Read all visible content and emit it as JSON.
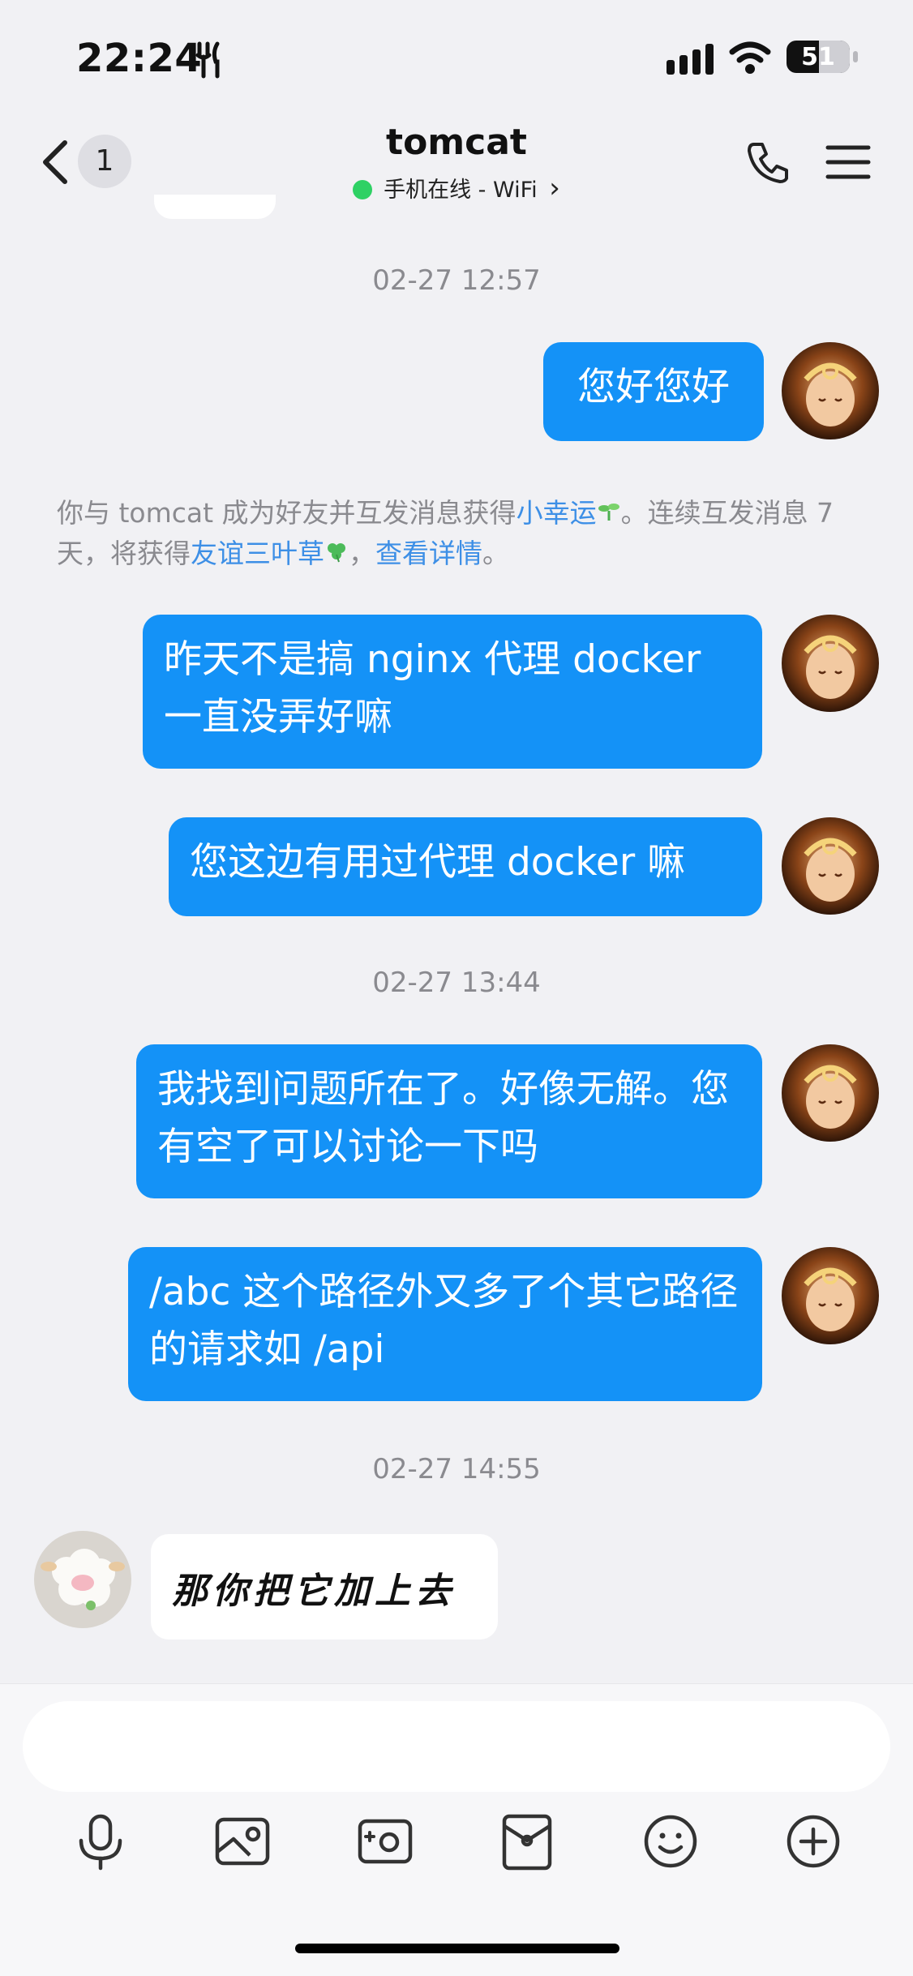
{
  "status_bar": {
    "time": "22:24",
    "battery": "51"
  },
  "header": {
    "unread_count": "1",
    "contact_name": "tomcat",
    "contact_status": "手机在线 - WiFi",
    "status_chevron": "›"
  },
  "top_partial_bubble": "",
  "messages": {
    "ts1": "02-27 12:57",
    "m1": "您好您好",
    "notice": {
      "p1": "你与 tomcat 成为好友并互发消息获得",
      "link1": "小幸运",
      "p2": "。连续互发消息 7 天，将获得",
      "link2": "友谊三叶草",
      "p3": "，",
      "link3": "查看详情",
      "p4": "。"
    },
    "m2": "昨天不是搞 nginx 代理 docker 一直没弄好嘛",
    "m3": "您这边有用过代理 docker 嘛",
    "ts2": "02-27 13:44",
    "m4": "我找到问题所在了。好像无解。您有空了可以讨论一下吗",
    "m5": "/abc 这个路径外又多了个其它路径的请求如 /api",
    "ts3": "02-27 14:55",
    "m6": "那你把它加上去"
  },
  "composer": {
    "placeholder": ""
  },
  "toolbar": {
    "icons": [
      "microphone-icon",
      "image-icon",
      "camera-icon",
      "red-packet-icon",
      "emoji-icon",
      "plus-icon"
    ]
  },
  "colors": {
    "outgoing_bubble": "#1492f7",
    "link": "#3d8fe6",
    "online": "#2ed164"
  }
}
